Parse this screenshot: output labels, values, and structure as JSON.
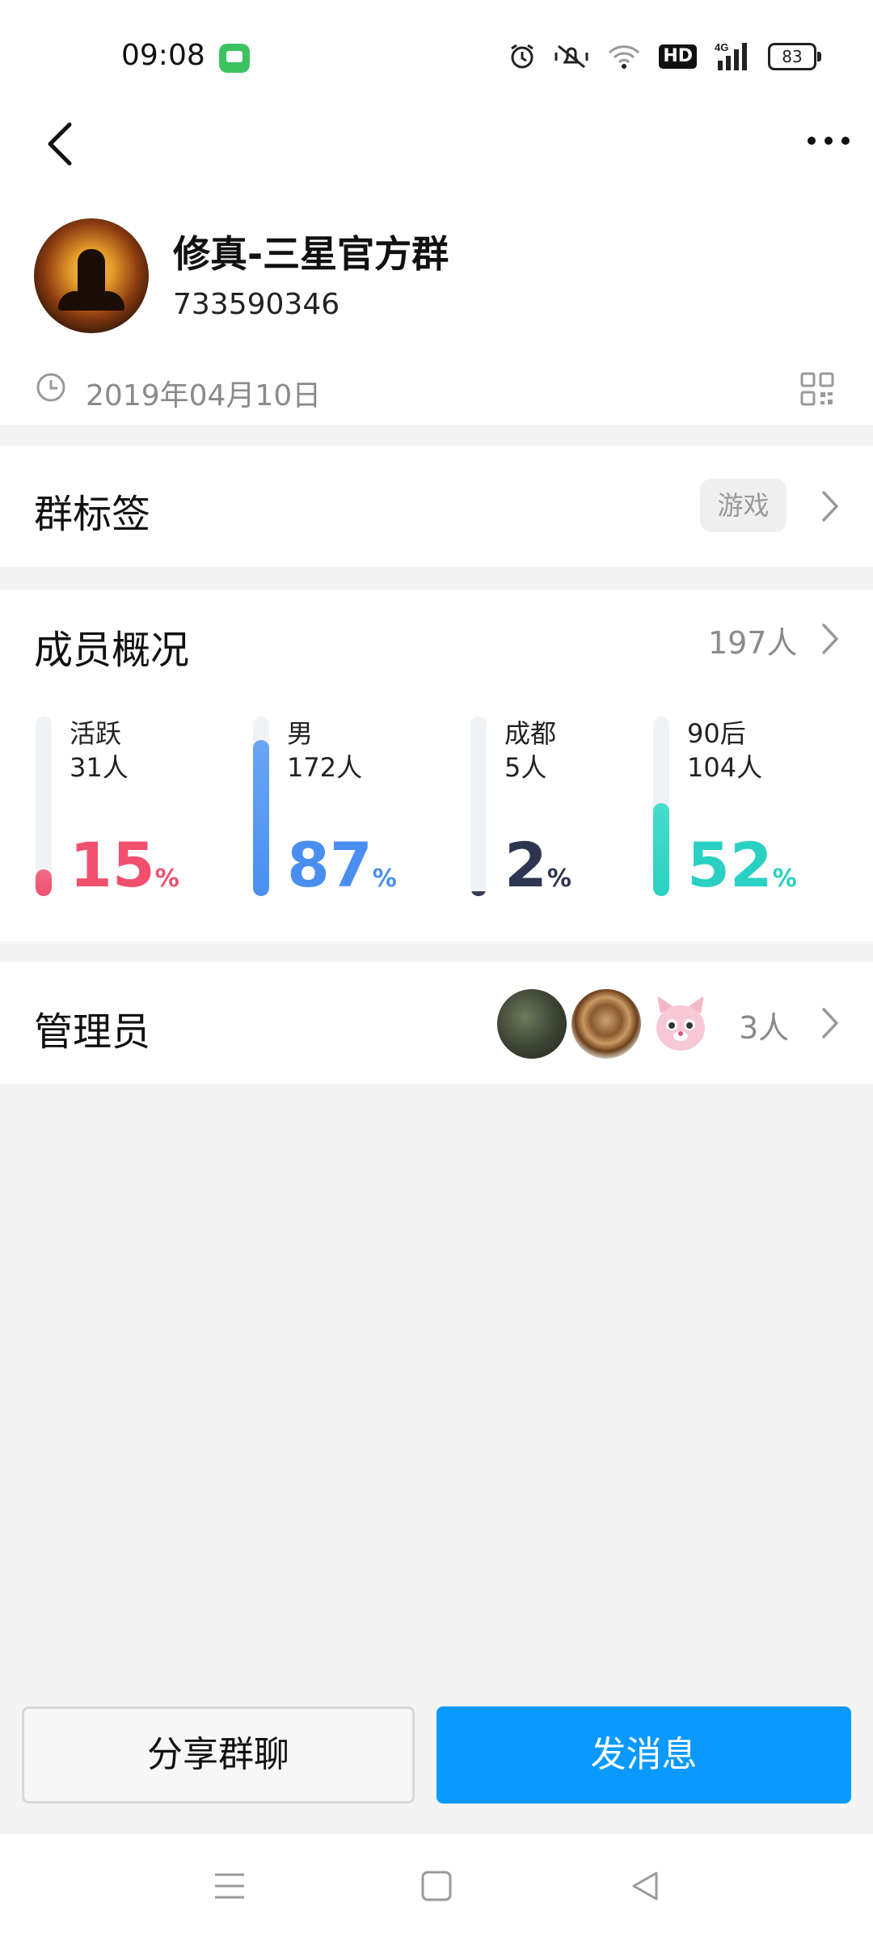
{
  "status_bar": {
    "time": "09:08",
    "hd": "HD",
    "network": "4G",
    "battery": "83"
  },
  "group": {
    "name": "修真-三星官方群",
    "id": "733590346",
    "created_date": "2019年04月10日"
  },
  "tags_row": {
    "title": "群标签",
    "tag": "游戏"
  },
  "members": {
    "title": "成员概况",
    "count": "197人",
    "stats": [
      {
        "label": "活跃",
        "count": "31人",
        "percent": "15",
        "sign": "%",
        "color": "#f0506e",
        "fill_color": "#f06b84",
        "level": 0.15
      },
      {
        "label": "男",
        "count": "172人",
        "percent": "87",
        "sign": "%",
        "color": "#4a8ff0",
        "fill_color": "#6aa5f4",
        "level": 0.87
      },
      {
        "label": "成都",
        "count": "5人",
        "percent": "2",
        "sign": "%",
        "color": "#2d3550",
        "fill_color": "#3a4260",
        "level": 0.02
      },
      {
        "label": "90后",
        "count": "104人",
        "percent": "52",
        "sign": "%",
        "color": "#2ad1c2",
        "fill_color": "#48dccc",
        "level": 0.52
      }
    ]
  },
  "admins": {
    "title": "管理员",
    "count": "3人"
  },
  "buttons": {
    "share": "分享群聊",
    "send": "发消息"
  },
  "icons": {
    "back": "back-arrow-icon",
    "more": "more-dots-icon",
    "clock": "clock-icon",
    "qr": "qr-code-icon",
    "chevron": "chevron-right-icon"
  }
}
